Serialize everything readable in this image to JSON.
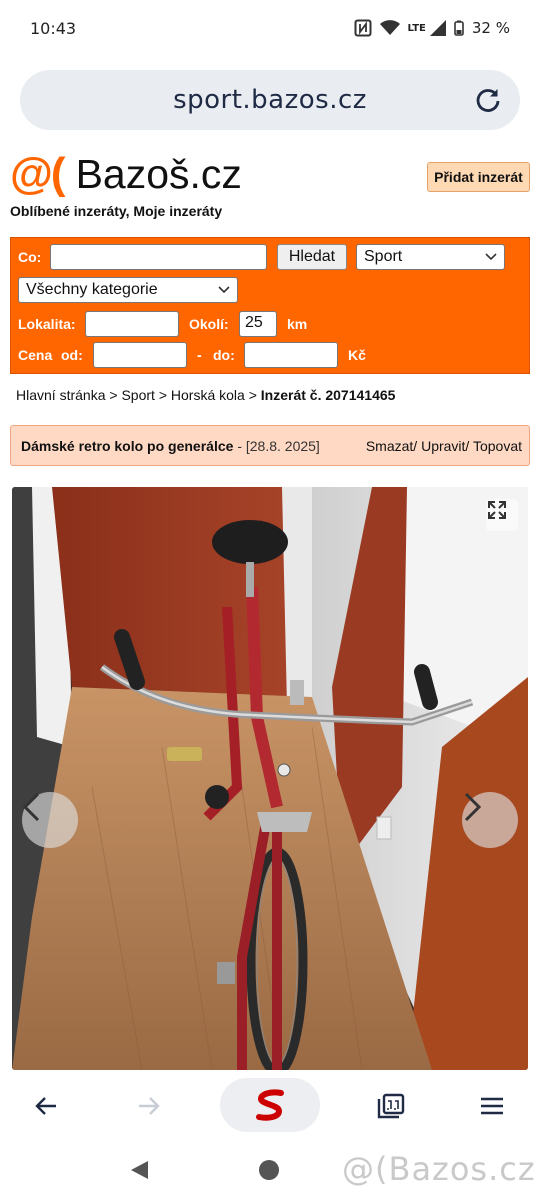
{
  "status": {
    "time": "10:43",
    "network": "LTE",
    "battery": "32 %"
  },
  "browser": {
    "url": "sport.bazos.cz"
  },
  "site": {
    "logo_at": "@(",
    "logo_name": "Bazoš.cz",
    "add_ad": "Přidat inzerát",
    "favorites": "Oblíbené inzeráty, Moje inzeráty"
  },
  "search": {
    "co_label": "Co:",
    "co_value": "",
    "search_button": "Hledat",
    "section_select": "Sport",
    "category_select": "Všechny kategorie",
    "location_label": "Lokalita:",
    "location_value": "",
    "radius_label": "Okolí:",
    "radius_value": "25",
    "radius_unit": "km",
    "price_label": "Cena",
    "price_from": "od:",
    "price_dash": "-",
    "price_to": "do:",
    "price_currency": "Kč"
  },
  "breadcrumb": {
    "home": "Hlavní stránka",
    "sep": ">",
    "section": "Sport",
    "category": "Horská kola",
    "current": "Inzerát č. 207141465"
  },
  "ad": {
    "title": "Dámské retro kolo po generálce",
    "date": "- [28.8. 2025]",
    "actions": "Smazat/ Upravit/ Topovat"
  },
  "watermark": "@(Bazos.cz",
  "colors": {
    "accent": "#ff6600",
    "adbar": "#ffd9c4"
  }
}
